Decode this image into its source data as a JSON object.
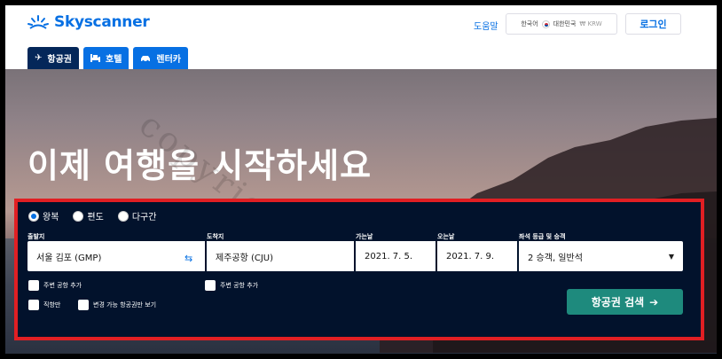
{
  "header": {
    "brand": "Skyscanner",
    "help": "도움말",
    "locale": {
      "language": "한국어",
      "country": "대한민국",
      "currency": "₩ KRW"
    },
    "login": "로그인"
  },
  "tabs": [
    {
      "label": "항공권",
      "icon": "plane-icon",
      "active": true
    },
    {
      "label": "호텔",
      "icon": "bed-icon",
      "active": false
    },
    {
      "label": "렌터카",
      "icon": "car-icon",
      "active": false
    }
  ],
  "hero": {
    "title": "이제 여행을 시작하세요"
  },
  "watermark": "copyright by bf",
  "search": {
    "trip_types": [
      {
        "label": "왕복",
        "selected": true
      },
      {
        "label": "편도",
        "selected": false
      },
      {
        "label": "다구간",
        "selected": false
      }
    ],
    "labels": {
      "from": "출발지",
      "to": "도착지",
      "depart": "가는날",
      "return": "오는날",
      "cabin": "좌석 등급 및 승객"
    },
    "values": {
      "from": "서울 김포 (GMP)",
      "to": "제주공항 (CJU)",
      "depart": "2021. 7. 5.",
      "return": "2021. 7. 9.",
      "cabin": "2 승객, 일반석"
    },
    "checkboxes": {
      "nearby_from": "주변 공항 추가",
      "nearby_to": "주변 공항 추가",
      "direct": "직항만",
      "flexible": "변경 가능 항공권만 보기"
    },
    "submit": "항공권 검색"
  },
  "colors": {
    "brand": "#0770e3",
    "panel": "#02122c",
    "highlight_border": "#e11f23",
    "search_button": "#1e8a7d"
  }
}
